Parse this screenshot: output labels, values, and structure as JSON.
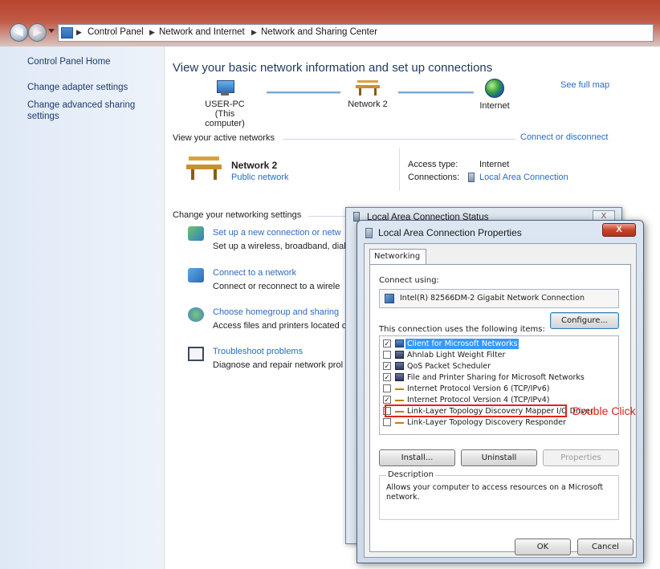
{
  "breadcrumb": [
    "Control Panel",
    "Network and Internet",
    "Network and Sharing Center"
  ],
  "left_nav": {
    "home": "Control Panel Home",
    "items": [
      "Change adapter settings",
      "Change advanced sharing settings"
    ]
  },
  "main": {
    "title": "View your basic network information and set up connections",
    "see_full_map": "See full map",
    "map_nodes": [
      {
        "name": "USER-PC",
        "sub": "(This computer)"
      },
      {
        "name": "Network 2"
      },
      {
        "name": "Internet"
      }
    ],
    "active_networks_label": "View your active networks",
    "connect_or_disconnect": "Connect or disconnect",
    "network_name": "Network 2",
    "network_type": "Public network",
    "access_type_label": "Access type:",
    "access_type_value": "Internet",
    "connections_label": "Connections:",
    "connections_value": "Local Area Connection",
    "change_settings_label": "Change your networking settings",
    "tasks": [
      {
        "title": "Set up a new connection or netw",
        "desc": "Set up a wireless, broadband, dial"
      },
      {
        "title": "Connect to a network",
        "desc": "Connect or reconnect to a wirele"
      },
      {
        "title": "Choose homegroup and sharing",
        "desc": "Access files and printers located c"
      },
      {
        "title": "Troubleshoot problems",
        "desc": "Diagnose and repair network prol"
      }
    ]
  },
  "status_window": {
    "title": "Local Area Connection Status",
    "close": "X"
  },
  "dialog": {
    "title": "Local Area Connection Properties",
    "close": "X",
    "tab": "Networking",
    "connect_using_label": "Connect using:",
    "adapter": "Intel(R) 82566DM-2 Gigabit Network Connection",
    "configure": "Configure...",
    "items_label": "This connection uses the following items:",
    "items": [
      {
        "label": "Client for Microsoft Networks",
        "checked": true,
        "icon": "client"
      },
      {
        "label": "Ahnlab Light Weight Filter",
        "checked": false,
        "icon": "service"
      },
      {
        "label": "QoS Packet Scheduler",
        "checked": true,
        "icon": "service"
      },
      {
        "label": "File and Printer Sharing for Microsoft Networks",
        "checked": true,
        "icon": "service"
      },
      {
        "label": "Internet Protocol Version 6 (TCP/IPv6)",
        "checked": false,
        "icon": "protocol"
      },
      {
        "label": "Internet Protocol Version 4 (TCP/IPv4)",
        "checked": true,
        "icon": "protocol"
      },
      {
        "label": "Link-Layer Topology Discovery Mapper I/O Driver",
        "checked": false,
        "icon": "protocol"
      },
      {
        "label": "Link-Layer Topology Discovery Responder",
        "checked": false,
        "icon": "protocol"
      }
    ],
    "install": "Install...",
    "uninstall": "Uninstall",
    "properties": "Properties",
    "description_label": "Description",
    "description": "Allows your computer to access resources on a Microsoft network.",
    "ok": "OK",
    "cancel": "Cancel"
  },
  "annotation": {
    "text": "Double Click",
    "color": "#e2231a"
  },
  "colors": {
    "link": "#2a6bc4",
    "selection": "#3399ff",
    "close_button": "#c8432b"
  }
}
